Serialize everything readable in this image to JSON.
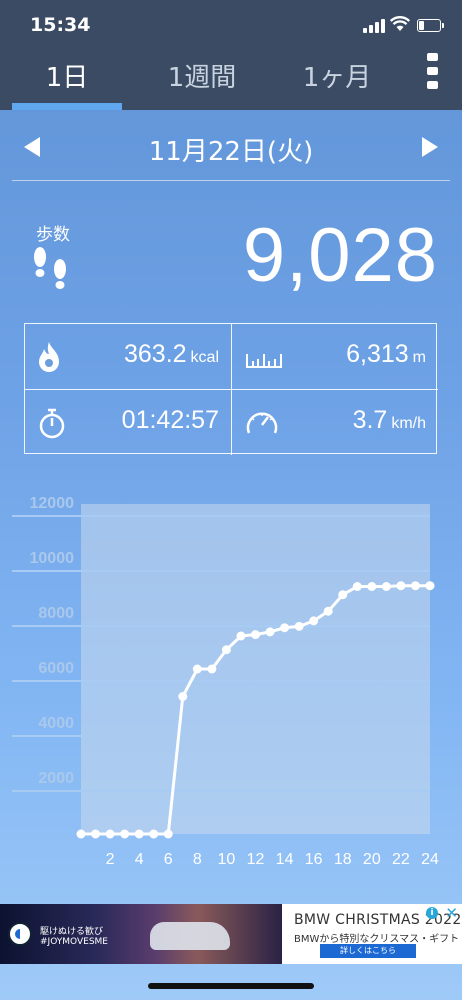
{
  "status": {
    "time": "15:34"
  },
  "tabs": [
    {
      "label": "1日",
      "active": true
    },
    {
      "label": "1週間",
      "active": false
    },
    {
      "label": "1ヶ月",
      "active": false
    }
  ],
  "date": "11月22日(火)",
  "steps": {
    "label": "歩数",
    "value": "9,028"
  },
  "stats": {
    "calories": {
      "value": "363.2",
      "unit": "kcal"
    },
    "distance": {
      "value": "6,313",
      "unit": "m"
    },
    "duration": {
      "value": "01:42:57"
    },
    "speed": {
      "value": "3.7",
      "unit": "km/h"
    }
  },
  "chart_data": {
    "type": "line",
    "x": [
      0,
      1,
      2,
      3,
      4,
      5,
      6,
      7,
      8,
      9,
      10,
      11,
      12,
      13,
      14,
      15,
      16,
      17,
      18,
      19,
      20,
      21,
      22,
      23,
      24
    ],
    "values": [
      0,
      0,
      0,
      0,
      0,
      0,
      0,
      5000,
      6000,
      6000,
      6700,
      7200,
      7250,
      7350,
      7500,
      7550,
      7750,
      8100,
      8700,
      9000,
      9000,
      9000,
      9028,
      9028,
      9028
    ],
    "xticks": [
      "2",
      "4",
      "6",
      "8",
      "10",
      "12",
      "14",
      "16",
      "18",
      "20",
      "22",
      "24"
    ],
    "yticks": [
      "2000",
      "4000",
      "6000",
      "8000",
      "10000",
      "12000"
    ],
    "xlim": [
      0,
      24
    ],
    "ylim": [
      0,
      12000
    ],
    "grid": true,
    "colors": {
      "line": "#ffffff",
      "area": "#c9d9ec"
    }
  },
  "ad": {
    "small_line1": "駆けぬける歓び",
    "small_line2": "#JOYMOVESME",
    "title": "BMW CHRISTMAS 2022",
    "subtitle": "BMWから特別なクリスマス・ギフト",
    "button": "詳しくはこちら"
  }
}
